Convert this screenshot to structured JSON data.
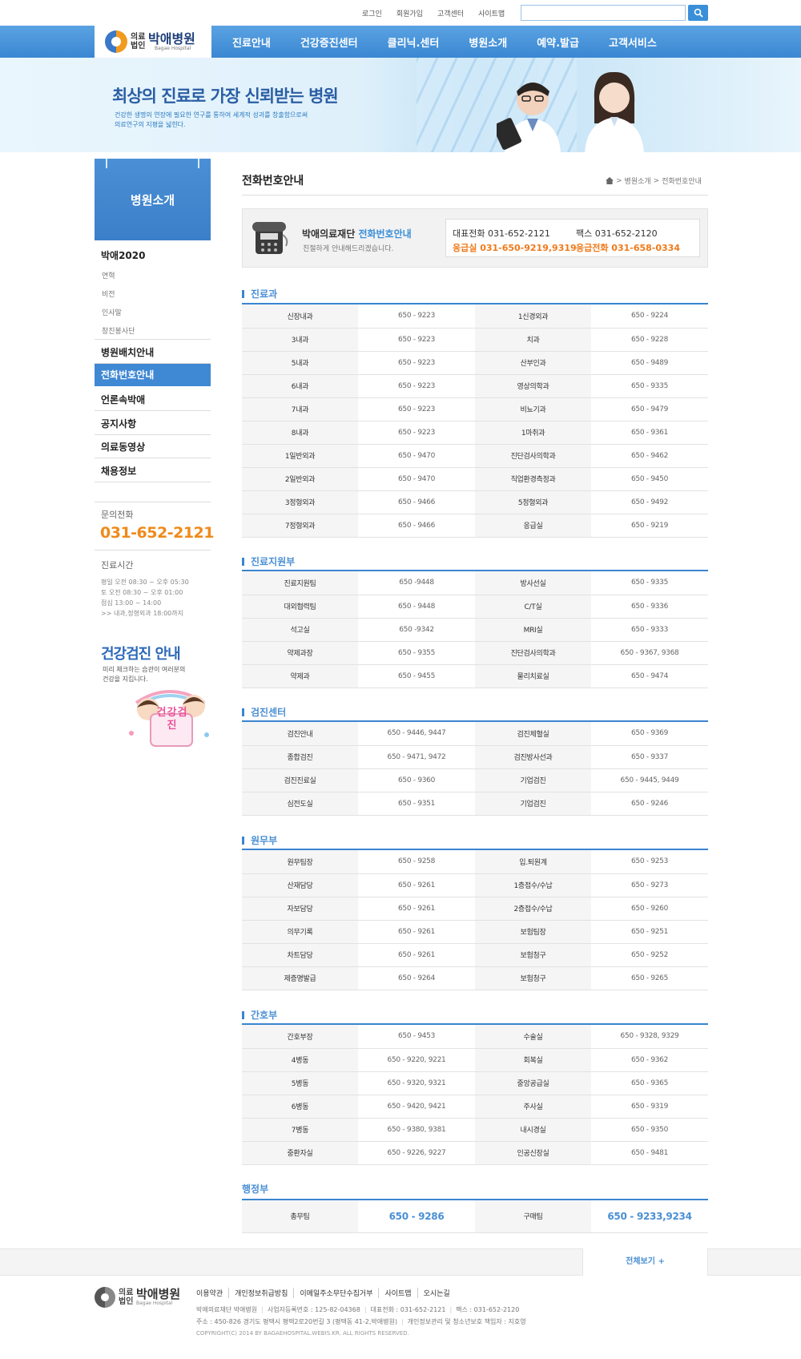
{
  "util": {
    "links": [
      "로그인",
      "회원가입",
      "고객센터",
      "사이트맵"
    ]
  },
  "logo": {
    "prefix": "의료\n법인",
    "name": "박애병원",
    "en": "Bagae Hospital"
  },
  "menu": [
    "진료안내",
    "건강증진센터",
    "클리닉.센터",
    "병원소개",
    "예약.발급",
    "고객서비스"
  ],
  "hero": {
    "title": "최상의 진료로 가장 신뢰받는 병원",
    "sub1": "건강한 생명의 연장에 필요한 연구를 통하여 세계적 성과를 창출함으로써",
    "sub2": "의료연구의 지평을 넓힌다."
  },
  "sidebar": {
    "title": "병원소개",
    "group1": "박애2020",
    "subs": [
      "연혁",
      "비전",
      "인사말",
      "창진봉사단"
    ],
    "items": [
      "병원배치안내",
      "전화번호안내",
      "언론속박애",
      "공지사항",
      "의료동영상",
      "채용정보"
    ],
    "call_label": "문의전화",
    "call_number": "031-652-2121",
    "hours_label": "진료시간",
    "hours": [
      "평일 오전 08:30 ~ 오후 05:30",
      "토 오전 08:30 ~ 오후 01:00",
      "점심 13:00 ~ 14:00",
      ">> 내과,정형외과 18:00까지"
    ],
    "checkup_title": "건강검진 안내",
    "checkup_sub": [
      "미리 체크하는 습관이 여러분의",
      "건강을 지킵니다."
    ],
    "illust_text": "건강검진"
  },
  "page": {
    "title": "전화번호안내",
    "crumb": [
      "병원소개",
      "전화번호안내"
    ]
  },
  "info": {
    "org": "박애의료재단",
    "heading": "전화번호안내",
    "sub": "친절하게 안내해드리겠습니다.",
    "main_phone": "대표전화 031-652-2121",
    "fax": "팩스 031-652-2120",
    "er": "응급실 031-650-9219,9319",
    "er_phone": "응급전화 031-658-0334"
  },
  "sections": [
    {
      "title": "진료과",
      "rows": [
        [
          "신장내과",
          "650 - 9223",
          "1신경외과",
          "650 - 9224"
        ],
        [
          "3내과",
          "650 - 9223",
          "치과",
          "650 - 9228"
        ],
        [
          "5내과",
          "650 - 9223",
          "산부인과",
          "650 - 9489"
        ],
        [
          "6내과",
          "650 - 9223",
          "영상의학과",
          "650 - 9335"
        ],
        [
          "7내과",
          "650 - 9223",
          "비뇨기과",
          "650 - 9479"
        ],
        [
          "8내과",
          "650 - 9223",
          "1마취과",
          "650 - 9361"
        ],
        [
          "1일반외과",
          "650 - 9470",
          "진단검사의학과",
          "650 - 9462"
        ],
        [
          "2일반외과",
          "650 - 9470",
          "직업환경측정과",
          "650 - 9450"
        ],
        [
          "3정형외과",
          "650 - 9466",
          "5정형외과",
          "650 - 9492"
        ],
        [
          "7정형외과",
          "650 - 9466",
          "응급실",
          "650 - 9219"
        ]
      ]
    },
    {
      "title": "진료지원부",
      "rows": [
        [
          "진료지원팀",
          "650 -9448",
          "방사선실",
          "650 - 9335"
        ],
        [
          "대외협력팀",
          "650 - 9448",
          "C/T실",
          "650 - 9336"
        ],
        [
          "석고실",
          "650 -9342",
          "MRI실",
          "650 - 9333"
        ],
        [
          "약제과장",
          "650 - 9355",
          "진단검사의학과",
          "650 - 9367, 9368"
        ],
        [
          "약제과",
          "650 - 9455",
          "물리치료실",
          "650 - 9474"
        ]
      ]
    },
    {
      "title": "검진센터",
      "rows": [
        [
          "검진안내",
          "650 - 9446, 9447",
          "검진체혈실",
          "650 - 9369"
        ],
        [
          "종합검진",
          "650 - 9471, 9472",
          "검진방사선과",
          "650 - 9337"
        ],
        [
          "검진진료실",
          "650 - 9360",
          "기업검진",
          "650 - 9445, 9449"
        ],
        [
          "심전도실",
          "650 - 9351",
          "기업검진",
          "650 - 9246"
        ]
      ]
    },
    {
      "title": "원무부",
      "rows": [
        [
          "원무팀장",
          "650 - 9258",
          "입.퇴원계",
          "650 - 9253"
        ],
        [
          "산재담당",
          "650 - 9261",
          "1층접수/수납",
          "650 - 9273"
        ],
        [
          "자보담당",
          "650 - 9261",
          "2층접수/수납",
          "650 - 9260"
        ],
        [
          "의무기록",
          "650 - 9261",
          "보험팀장",
          "650 - 9251"
        ],
        [
          "차트담당",
          "650 - 9261",
          "보험청구",
          "650 - 9252"
        ],
        [
          "제증명발급",
          "650 - 9264",
          "보험청구",
          "650 - 9265"
        ]
      ]
    },
    {
      "title": "간호부",
      "rows": [
        [
          "간호부장",
          "650 - 9453",
          "수술실",
          "650 - 9328, 9329"
        ],
        [
          "4병동",
          "650 - 9220, 9221",
          "회복실",
          "650 - 9362"
        ],
        [
          "5병동",
          "650 - 9320, 9321",
          "중앙공급실",
          "650 - 9365"
        ],
        [
          "6병동",
          "650 - 9420, 9421",
          "주사실",
          "650 - 9319"
        ],
        [
          "7병동",
          "650 - 9380, 9381",
          "내시경실",
          "650 - 9350"
        ],
        [
          "중환자실",
          "650 - 9226, 9227",
          "인공신장실",
          "650 - 9481"
        ]
      ]
    }
  ],
  "admin": {
    "title": "행정부",
    "row": [
      "총무팀",
      "650 - 9286",
      "구매팀",
      "650 - 9233,9234"
    ]
  },
  "footer": {
    "viewall": "전체보기 +",
    "links": [
      "이용약관",
      "개인정보취급방침",
      "이메일주소무단수집거부",
      "사이트맵",
      "오시는길"
    ],
    "line1": [
      "박애의료재단 박애병원",
      "사업자등록번호 : 125-82-04368",
      "대표전화 : 031-652-2121",
      "팩스 : 031-652-2120"
    ],
    "line2": [
      "주소 : 450-826 경기도 평택시 평택2로20번길 3 (평택동 41-2,박애병원)",
      "개인정보관리 및 청소년보호 책임자 : 지호영"
    ],
    "copyright": "COPYRIGHT(C) 2014 BY BAGAEHOSPITAL.WEBIS.KR. ALL RIGHTS RESERVED."
  }
}
